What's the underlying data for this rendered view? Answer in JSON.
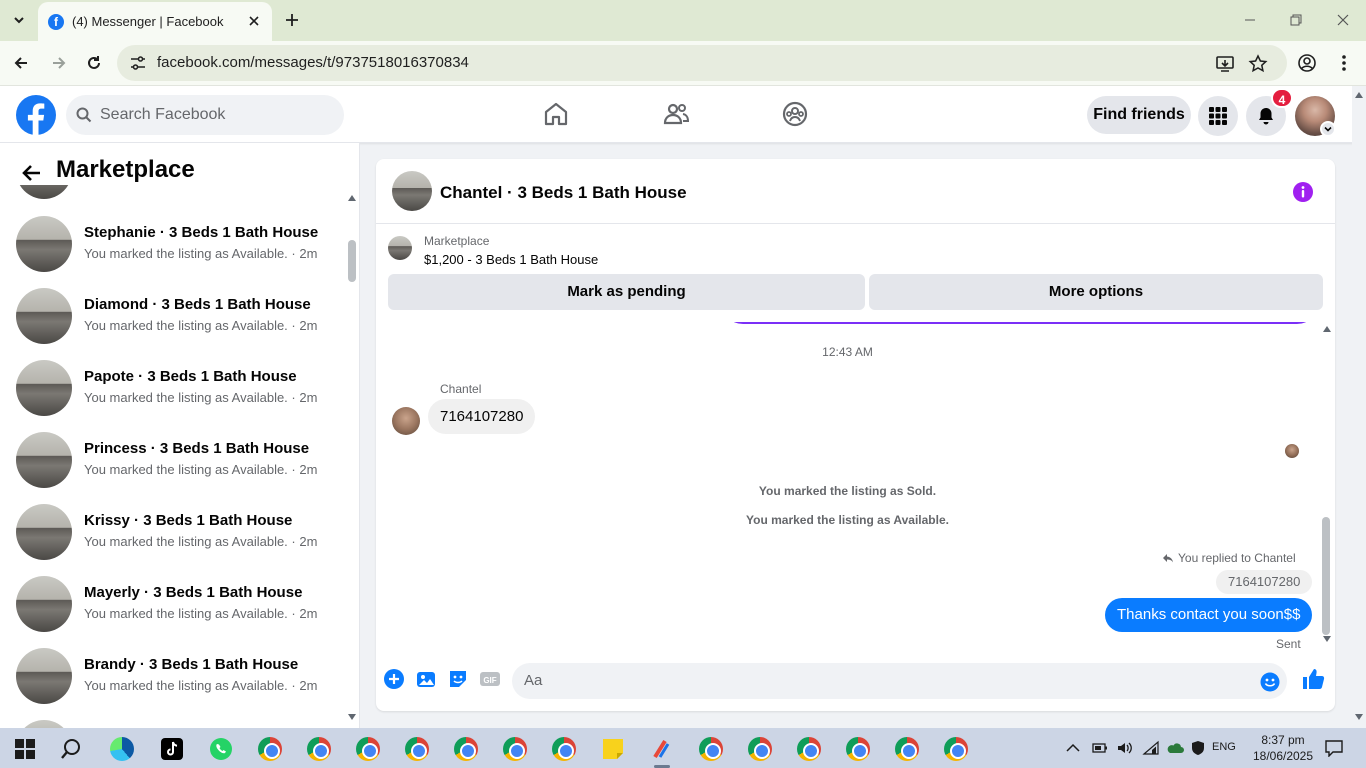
{
  "browser": {
    "tab_title": "(4) Messenger | Facebook",
    "url": "facebook.com/messages/t/9737518016370834"
  },
  "fb": {
    "search_placeholder": "Search Facebook",
    "find_friends": "Find friends",
    "notif_count": "4"
  },
  "sidebar": {
    "title": "Marketplace",
    "conversations": [
      {
        "name": "Stephanie · 3 Beds 1 Bath House",
        "preview": "You marked the listing as Available. · 2m"
      },
      {
        "name": "Diamond · 3 Beds 1 Bath House",
        "preview": "You marked the listing as Available. · 2m"
      },
      {
        "name": "Papote · 3 Beds 1 Bath House",
        "preview": "You marked the listing as Available. · 2m"
      },
      {
        "name": "Princess · 3 Beds 1 Bath House",
        "preview": "You marked the listing as Available. · 2m"
      },
      {
        "name": "Krissy · 3 Beds 1 Bath House",
        "preview": "You marked the listing as Available. · 2m"
      },
      {
        "name": "Mayerly · 3 Beds 1 Bath House",
        "preview": "You marked the listing as Available. · 2m"
      },
      {
        "name": "Brandy · 3 Beds 1 Bath House",
        "preview": "You marked the listing as Available. · 2m"
      }
    ]
  },
  "chat": {
    "title": "Chantel · 3 Beds 1 Bath House",
    "listing_category": "Marketplace",
    "listing_info": "$1,200 - 3 Beds 1 Bath House",
    "mark_pending": "Mark as pending",
    "more_options": "More options",
    "time_separator": "12:43 AM",
    "sender_name": "Chantel",
    "incoming_message": "7164107280",
    "system_sold": "You marked the listing as Sold.",
    "system_available": "You marked the listing as Available.",
    "reply_note": "You replied to Chantel",
    "reply_quote": "7164107280",
    "outgoing_message": "Thanks contact you soon$$",
    "status": "Sent",
    "input_placeholder": "Aa"
  },
  "taskbar": {
    "language": "ENG",
    "time": "8:37 pm",
    "date": "18/06/2025"
  },
  "colors": {
    "fb_blue": "#1877f2",
    "message_blue": "#0a7cff",
    "accent_purple": "#7b2ff7",
    "badge_red": "#e41e3f"
  }
}
